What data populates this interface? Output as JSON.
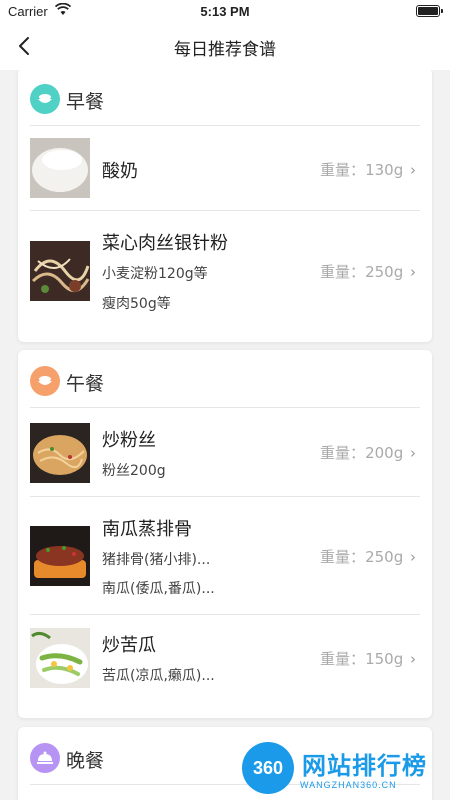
{
  "status_bar": {
    "carrier": "Carrier",
    "time": "5:13 PM"
  },
  "nav": {
    "title": "每日推荐食谱",
    "back_icon": "chevron-left-icon"
  },
  "meals": [
    {
      "title": "早餐",
      "icon_color": "#4fd1c5",
      "items": [
        {
          "name": "酸奶",
          "subs": [],
          "weight_label": "重量：",
          "weight": "130g"
        },
        {
          "name": "菜心肉丝银针粉",
          "subs": [
            "小麦淀粉120g等",
            "瘦肉50g等"
          ],
          "weight_label": "重量：",
          "weight": "250g"
        }
      ]
    },
    {
      "title": "午餐",
      "icon_color": "#f6a06b",
      "items": [
        {
          "name": "炒粉丝",
          "subs": [
            "粉丝200g"
          ],
          "weight_label": "重量：",
          "weight": "200g"
        },
        {
          "name": "南瓜蒸排骨",
          "subs": [
            "猪排骨(猪小排)...",
            "南瓜(倭瓜,番瓜)..."
          ],
          "weight_label": "重量：",
          "weight": "250g"
        },
        {
          "name": "炒苦瓜",
          "subs": [
            "苦瓜(凉瓜,癞瓜)..."
          ],
          "weight_label": "重量：",
          "weight": "150g"
        }
      ]
    },
    {
      "title": "晚餐",
      "icon_color": "#b794f4",
      "items": []
    }
  ],
  "watermark": {
    "logo": "360",
    "brand": "网站排行榜",
    "domain": "WANGZHAN360.CN"
  }
}
